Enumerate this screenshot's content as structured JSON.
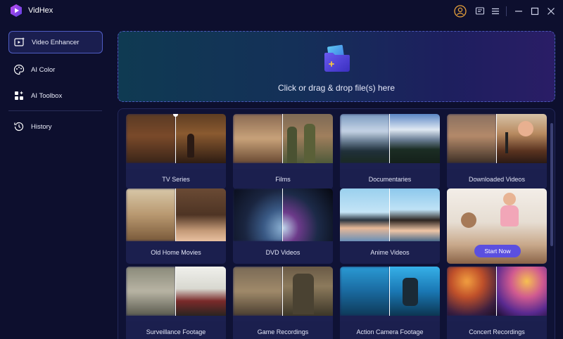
{
  "app": {
    "name": "VidHex",
    "brand_color": "#7c3aed"
  },
  "titlebar": {
    "icons": [
      "user-icon",
      "feedback-icon",
      "menu-icon",
      "minimize-icon",
      "maximize-icon",
      "close-icon"
    ]
  },
  "sidebar": {
    "items": [
      {
        "label": "Video Enhancer",
        "icon": "video-enhance-icon",
        "active": true
      },
      {
        "label": "AI Color",
        "icon": "palette-icon",
        "active": false
      },
      {
        "label": "AI Toolbox",
        "icon": "toolbox-icon",
        "active": false
      },
      {
        "label": "History",
        "icon": "history-icon",
        "active": false
      }
    ]
  },
  "dropzone": {
    "text": "Click or drag & drop file(s) here",
    "icon": "add-folder-icon"
  },
  "cards": [
    {
      "label": "TV Series"
    },
    {
      "label": "Films"
    },
    {
      "label": "Documentaries"
    },
    {
      "label": "Downloaded Videos"
    },
    {
      "label": "Old Home Movies"
    },
    {
      "label": "DVD Videos"
    },
    {
      "label": "Anime Videos"
    },
    {
      "label": "",
      "button": "Start Now"
    },
    {
      "label": "Surveillance Footage"
    },
    {
      "label": "Game Recordings"
    },
    {
      "label": "Action Camera Footage"
    },
    {
      "label": "Concert Recordings"
    }
  ],
  "colors": {
    "background": "#0d0f2e",
    "accent": "#5b4fe0",
    "active_border": "#4f5dc4"
  }
}
